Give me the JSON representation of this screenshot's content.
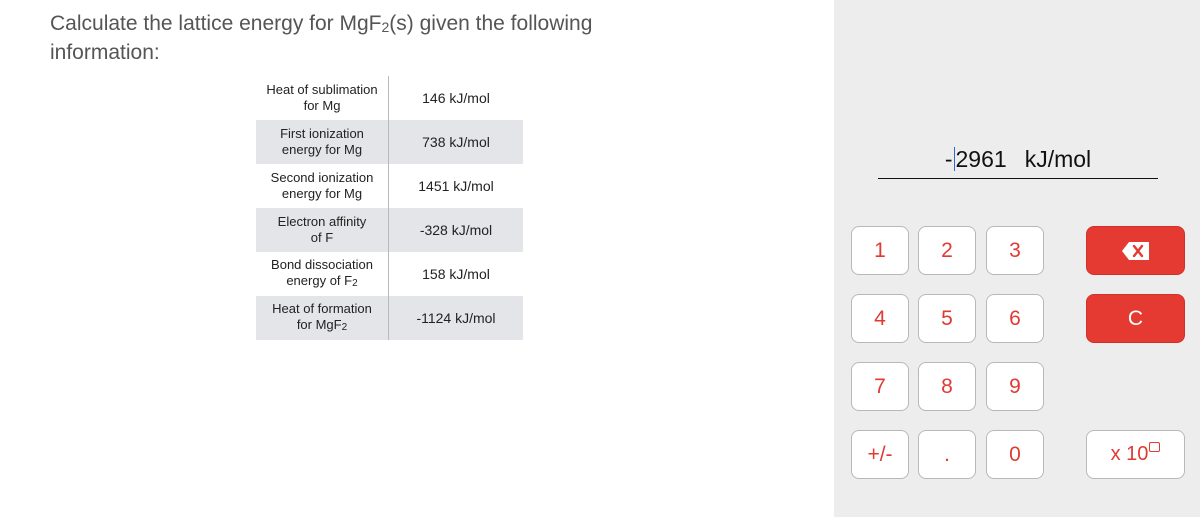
{
  "question": {
    "line_prefix": "Calculate the lattice energy for MgF",
    "sub": "2",
    "line_suffix": "(s) given the following information:"
  },
  "table": {
    "rows": [
      {
        "label_line1": "Heat of sublimation",
        "label_line2": "for Mg",
        "label_sub": "",
        "value": "146 kJ/mol",
        "shaded": false
      },
      {
        "label_line1": "First ionization",
        "label_line2": "energy for Mg",
        "label_sub": "",
        "value": "738 kJ/mol",
        "shaded": true
      },
      {
        "label_line1": "Second ionization",
        "label_line2": "energy for Mg",
        "label_sub": "",
        "value": "1451 kJ/mol",
        "shaded": false
      },
      {
        "label_line1": "Electron affinity",
        "label_line2": "of F",
        "label_sub": "",
        "value": "-328 kJ/mol",
        "shaded": true
      },
      {
        "label_line1": "Bond dissociation",
        "label_line2": "energy of F",
        "label_sub": "2",
        "value": "158 kJ/mol",
        "shaded": false
      },
      {
        "label_line1": "Heat of formation",
        "label_line2": "for MgF",
        "label_sub": "2",
        "value": "-1124 kJ/mol",
        "shaded": true
      }
    ]
  },
  "calculator": {
    "answer_sign": "-",
    "answer_value": "2961",
    "answer_unit": "kJ/mol",
    "keys": {
      "k1": "1",
      "k2": "2",
      "k3": "3",
      "k4": "4",
      "k5": "5",
      "k6": "6",
      "k7": "7",
      "k8": "8",
      "k9": "9",
      "sign": "+/-",
      "dot": ".",
      "k0": "0",
      "clear": "C",
      "sci": "x 10"
    },
    "backspace_icon": "backspace-icon",
    "colors": {
      "accent": "#e53a31",
      "key_text": "#e03a33",
      "panel_bg": "#ededed"
    }
  }
}
